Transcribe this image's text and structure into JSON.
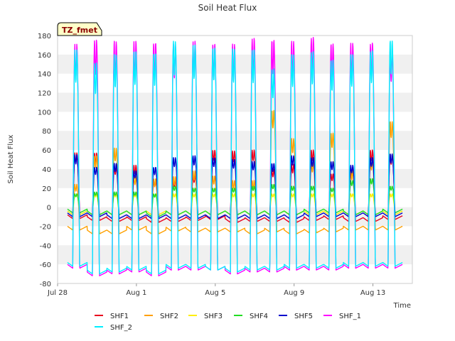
{
  "chart_data": {
    "type": "line",
    "title": "Soil Heat Flux",
    "xlabel": "Time",
    "ylabel": "Soil Heat Flux",
    "badge": "TZ_fmet",
    "ylim": [
      -80,
      180
    ],
    "xlim": [
      0,
      18
    ],
    "yticks": [
      -80,
      -60,
      -40,
      -20,
      0,
      20,
      40,
      60,
      80,
      100,
      120,
      140,
      160,
      180
    ],
    "xticks": [
      {
        "label": "Jul 28",
        "day": 0
      },
      {
        "label": "Aug 1",
        "day": 4
      },
      {
        "label": "Aug 5",
        "day": 8
      },
      {
        "label": "Aug 9",
        "day": 12
      },
      {
        "label": "Aug 13",
        "day": 16
      }
    ],
    "grid": "horizontal-bands",
    "legend": "bottom",
    "day_start": 0.5,
    "series": [
      {
        "name": "SHF1",
        "color": "#e8001e",
        "night": [
          -12,
          -14,
          -15,
          -14,
          -16,
          -15,
          -14,
          -13,
          -16,
          -15,
          -15,
          -16,
          -14,
          -13,
          -15,
          -15,
          -13
        ],
        "peak": [
          57,
          57,
          43,
          44,
          28,
          28,
          33,
          60,
          59,
          60,
          40,
          45,
          60,
          35,
          40,
          60,
          55
        ]
      },
      {
        "name": "SHF2",
        "color": "#ffa000",
        "night": [
          -24,
          -28,
          -28,
          -24,
          -28,
          -25,
          -26,
          -26,
          -26,
          -28,
          -26,
          -28,
          -27,
          -26,
          -24,
          -24,
          -24
        ],
        "peak": [
          24,
          54,
          62,
          32,
          30,
          32,
          38,
          33,
          28,
          28,
          102,
          72,
          48,
          78,
          38,
          50,
          90
        ]
      },
      {
        "name": "SHF3",
        "color": "#ffee00",
        "night": [
          -8,
          -8,
          -8,
          -8,
          -8,
          -8,
          -8,
          -8,
          -8,
          -8,
          -8,
          -8,
          -8,
          -8,
          -8,
          -8,
          -8
        ],
        "peak": [
          14,
          14,
          14,
          14,
          14,
          14,
          14,
          14,
          14,
          14,
          14,
          14,
          14,
          14,
          14,
          14,
          14
        ]
      },
      {
        "name": "SHF4",
        "color": "#22dd22",
        "night": [
          -6,
          -8,
          -8,
          -8,
          -10,
          -8,
          -8,
          -8,
          -8,
          -8,
          -8,
          -8,
          -6,
          -6,
          -8,
          -8,
          -6
        ],
        "peak": [
          14,
          16,
          16,
          16,
          14,
          22,
          20,
          20,
          20,
          22,
          24,
          22,
          22,
          20,
          28,
          30,
          22
        ]
      },
      {
        "name": "SHF5",
        "color": "#0000cc",
        "night": [
          -10,
          -10,
          -12,
          -12,
          -12,
          -12,
          -12,
          -12,
          -12,
          -12,
          -12,
          -12,
          -10,
          -10,
          -10,
          -10,
          -10
        ],
        "peak": [
          55,
          42,
          46,
          38,
          42,
          52,
          54,
          52,
          50,
          48,
          46,
          54,
          52,
          48,
          44,
          52,
          56
        ]
      },
      {
        "name": "SHF_1",
        "color": "#ff00ff",
        "night": [
          -64,
          -72,
          -70,
          -68,
          -72,
          -66,
          -66,
          -66,
          -70,
          -68,
          -68,
          -66,
          -66,
          -66,
          -64,
          -64,
          -64
        ],
        "peak": [
          171,
          176,
          174,
          174,
          173,
          171,
          174,
          172,
          171,
          177,
          176,
          174,
          178,
          172,
          172,
          172,
          166
        ]
      },
      {
        "name": "SHF_2",
        "color": "#00eeff",
        "night": [
          -62,
          -70,
          -68,
          -66,
          -70,
          -64,
          -64,
          -66,
          -68,
          -66,
          -66,
          -64,
          -64,
          -64,
          -62,
          -62,
          -62
        ],
        "peak": [
          165,
          152,
          160,
          163,
          162,
          174,
          170,
          168,
          166,
          165,
          146,
          160,
          163,
          155,
          160,
          164,
          175
        ]
      }
    ]
  }
}
